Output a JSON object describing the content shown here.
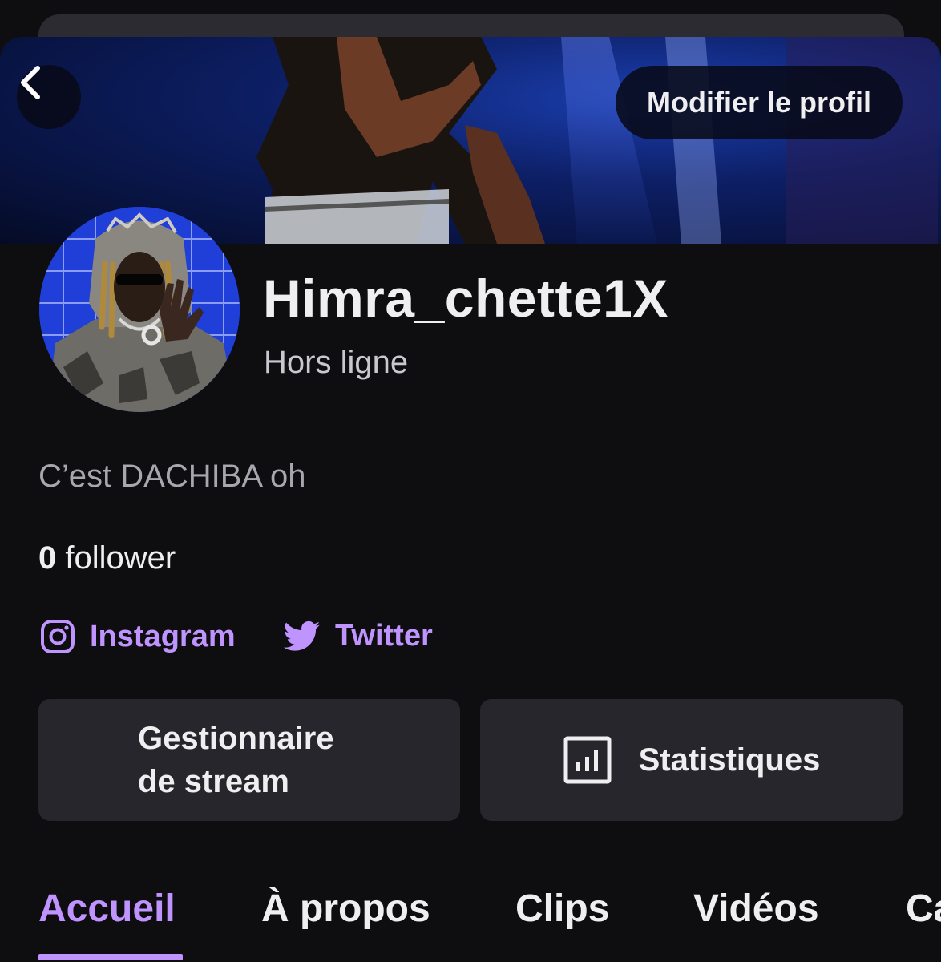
{
  "header": {
    "edit_profile_label": "Modifier le profil"
  },
  "profile": {
    "username": "Himra_chette1X",
    "status": "Hors ligne",
    "bio": "C’est DACHIBA oh",
    "followers_count": "0",
    "followers_label": " follower"
  },
  "social_links": [
    {
      "label": "Instagram",
      "icon": "instagram-icon"
    },
    {
      "label": "Twitter",
      "icon": "twitter-icon"
    }
  ],
  "actions": {
    "stream_manager_line1": "Gestionnaire",
    "stream_manager_line2": "de stream",
    "statistics_label": "Statistiques"
  },
  "tabs": [
    {
      "label": "Accueil",
      "active": true
    },
    {
      "label": "À propos",
      "active": false
    },
    {
      "label": "Clips",
      "active": false
    },
    {
      "label": "Vidéos",
      "active": false
    },
    {
      "label": "Ca",
      "active": false
    }
  ],
  "colors": {
    "accent": "#bf94ff",
    "background": "#0e0e10",
    "button_bg": "#26262c"
  }
}
